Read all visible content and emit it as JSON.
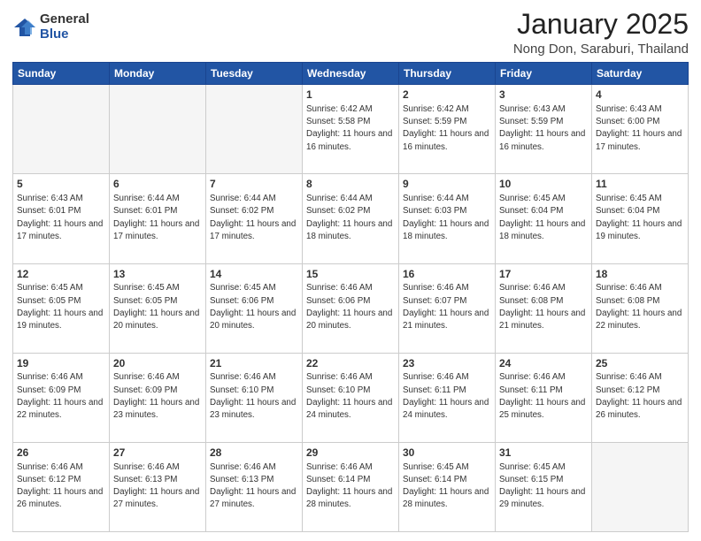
{
  "logo": {
    "general": "General",
    "blue": "Blue"
  },
  "header": {
    "title": "January 2025",
    "subtitle": "Nong Don, Saraburi, Thailand"
  },
  "weekdays": [
    "Sunday",
    "Monday",
    "Tuesday",
    "Wednesday",
    "Thursday",
    "Friday",
    "Saturday"
  ],
  "weeks": [
    [
      {
        "day": "",
        "info": ""
      },
      {
        "day": "",
        "info": ""
      },
      {
        "day": "",
        "info": ""
      },
      {
        "day": "1",
        "info": "Sunrise: 6:42 AM\nSunset: 5:58 PM\nDaylight: 11 hours and 16 minutes."
      },
      {
        "day": "2",
        "info": "Sunrise: 6:42 AM\nSunset: 5:59 PM\nDaylight: 11 hours and 16 minutes."
      },
      {
        "day": "3",
        "info": "Sunrise: 6:43 AM\nSunset: 5:59 PM\nDaylight: 11 hours and 16 minutes."
      },
      {
        "day": "4",
        "info": "Sunrise: 6:43 AM\nSunset: 6:00 PM\nDaylight: 11 hours and 17 minutes."
      }
    ],
    [
      {
        "day": "5",
        "info": "Sunrise: 6:43 AM\nSunset: 6:01 PM\nDaylight: 11 hours and 17 minutes."
      },
      {
        "day": "6",
        "info": "Sunrise: 6:44 AM\nSunset: 6:01 PM\nDaylight: 11 hours and 17 minutes."
      },
      {
        "day": "7",
        "info": "Sunrise: 6:44 AM\nSunset: 6:02 PM\nDaylight: 11 hours and 17 minutes."
      },
      {
        "day": "8",
        "info": "Sunrise: 6:44 AM\nSunset: 6:02 PM\nDaylight: 11 hours and 18 minutes."
      },
      {
        "day": "9",
        "info": "Sunrise: 6:44 AM\nSunset: 6:03 PM\nDaylight: 11 hours and 18 minutes."
      },
      {
        "day": "10",
        "info": "Sunrise: 6:45 AM\nSunset: 6:04 PM\nDaylight: 11 hours and 18 minutes."
      },
      {
        "day": "11",
        "info": "Sunrise: 6:45 AM\nSunset: 6:04 PM\nDaylight: 11 hours and 19 minutes."
      }
    ],
    [
      {
        "day": "12",
        "info": "Sunrise: 6:45 AM\nSunset: 6:05 PM\nDaylight: 11 hours and 19 minutes."
      },
      {
        "day": "13",
        "info": "Sunrise: 6:45 AM\nSunset: 6:05 PM\nDaylight: 11 hours and 20 minutes."
      },
      {
        "day": "14",
        "info": "Sunrise: 6:45 AM\nSunset: 6:06 PM\nDaylight: 11 hours and 20 minutes."
      },
      {
        "day": "15",
        "info": "Sunrise: 6:46 AM\nSunset: 6:06 PM\nDaylight: 11 hours and 20 minutes."
      },
      {
        "day": "16",
        "info": "Sunrise: 6:46 AM\nSunset: 6:07 PM\nDaylight: 11 hours and 21 minutes."
      },
      {
        "day": "17",
        "info": "Sunrise: 6:46 AM\nSunset: 6:08 PM\nDaylight: 11 hours and 21 minutes."
      },
      {
        "day": "18",
        "info": "Sunrise: 6:46 AM\nSunset: 6:08 PM\nDaylight: 11 hours and 22 minutes."
      }
    ],
    [
      {
        "day": "19",
        "info": "Sunrise: 6:46 AM\nSunset: 6:09 PM\nDaylight: 11 hours and 22 minutes."
      },
      {
        "day": "20",
        "info": "Sunrise: 6:46 AM\nSunset: 6:09 PM\nDaylight: 11 hours and 23 minutes."
      },
      {
        "day": "21",
        "info": "Sunrise: 6:46 AM\nSunset: 6:10 PM\nDaylight: 11 hours and 23 minutes."
      },
      {
        "day": "22",
        "info": "Sunrise: 6:46 AM\nSunset: 6:10 PM\nDaylight: 11 hours and 24 minutes."
      },
      {
        "day": "23",
        "info": "Sunrise: 6:46 AM\nSunset: 6:11 PM\nDaylight: 11 hours and 24 minutes."
      },
      {
        "day": "24",
        "info": "Sunrise: 6:46 AM\nSunset: 6:11 PM\nDaylight: 11 hours and 25 minutes."
      },
      {
        "day": "25",
        "info": "Sunrise: 6:46 AM\nSunset: 6:12 PM\nDaylight: 11 hours and 26 minutes."
      }
    ],
    [
      {
        "day": "26",
        "info": "Sunrise: 6:46 AM\nSunset: 6:12 PM\nDaylight: 11 hours and 26 minutes."
      },
      {
        "day": "27",
        "info": "Sunrise: 6:46 AM\nSunset: 6:13 PM\nDaylight: 11 hours and 27 minutes."
      },
      {
        "day": "28",
        "info": "Sunrise: 6:46 AM\nSunset: 6:13 PM\nDaylight: 11 hours and 27 minutes."
      },
      {
        "day": "29",
        "info": "Sunrise: 6:46 AM\nSunset: 6:14 PM\nDaylight: 11 hours and 28 minutes."
      },
      {
        "day": "30",
        "info": "Sunrise: 6:45 AM\nSunset: 6:14 PM\nDaylight: 11 hours and 28 minutes."
      },
      {
        "day": "31",
        "info": "Sunrise: 6:45 AM\nSunset: 6:15 PM\nDaylight: 11 hours and 29 minutes."
      },
      {
        "day": "",
        "info": ""
      }
    ]
  ]
}
